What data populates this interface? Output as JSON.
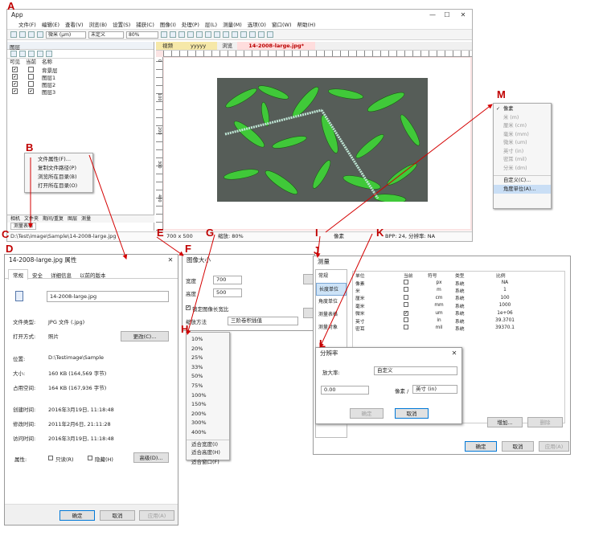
{
  "labels": {
    "A": "A",
    "B": "B",
    "C": "C",
    "D": "D",
    "E": "E",
    "F": "F",
    "G": "G",
    "H": "H",
    "I": "I",
    "J": "J",
    "K": "K",
    "L": "L",
    "M": "M"
  },
  "main": {
    "title": "App",
    "menus": [
      "文件(F)",
      "编辑(E)",
      "查看(V)",
      "浏览(B)",
      "设置(S)",
      "捕获(C)",
      "图像(I)",
      "处理(P)",
      "层(L)",
      "测量(M)",
      "选项(O)",
      "窗口(W)",
      "帮助(H)"
    ],
    "unit_select": "微米 (μm)",
    "calib_select": "未定义",
    "zoom_select": "80%",
    "layers_title": "图层",
    "layers_headers": [
      "可见",
      "当前",
      "名称"
    ],
    "layers": [
      {
        "name": "背景层",
        "vis": "✔",
        "cur": ""
      },
      {
        "name": "图层1",
        "vis": "✔",
        "cur": ""
      },
      {
        "name": "图层2",
        "vis": "✔",
        "cur": ""
      },
      {
        "name": "图层3",
        "vis": "✔",
        "cur": "✔"
      }
    ],
    "bottom_tabs": [
      "相机",
      "文件夹",
      "期间/重复",
      "图层",
      "测量"
    ],
    "bottom_tab2": "测量表格",
    "doc_tabs": [
      "视频",
      "yyyyy",
      "浏览",
      "14-2008-large.jpg*"
    ],
    "ruler_v": [
      "0",
      "100",
      "200",
      "300",
      "400"
    ],
    "status": {
      "path": "D:\\Test\\image\\Sample\\14-2008-large.jpg",
      "size": "700 x 500",
      "zoom": "缩放: 80%",
      "unit": "像素",
      "bpp": "BPP: 24, 分辨率: NA"
    }
  },
  "context_menu": {
    "items": [
      "文件属性(F)...",
      "复制文件路径(P)",
      "浏览所在目录(B)",
      "打开所在目录(O)"
    ]
  },
  "props": {
    "title": "14-2008-large.jpg 属性",
    "tabs": [
      "常规",
      "安全",
      "详细信息",
      "以前的版本"
    ],
    "filename": "14-2008-large.jpg",
    "rows": [
      {
        "k": "文件类型:",
        "v": "JPG 文件 (.jpg)"
      },
      {
        "k": "打开方式:",
        "v": "照片"
      },
      {
        "k": "位置:",
        "v": "D:\\Testimage\\Sample"
      },
      {
        "k": "大小:",
        "v": "160 KB (164,569 字节)"
      },
      {
        "k": "占用空间:",
        "v": "164 KB (167,936 字节)"
      },
      {
        "k": "创建时间:",
        "v": "2016年3月19日, 11:18:48"
      },
      {
        "k": "修改时间:",
        "v": "2011年2月6日, 21:11:28"
      },
      {
        "k": "访问时间:",
        "v": "2016年3月19日, 11:18:48"
      }
    ],
    "change_btn": "更改(C)...",
    "attr_label": "属性:",
    "readonly": "只读(R)",
    "hidden": "隐藏(H)",
    "advanced": "高级(D)...",
    "ok": "确定",
    "cancel": "取消",
    "apply": "应用(A)"
  },
  "resize": {
    "title": "图像大小",
    "width_label": "宽度",
    "width": "700",
    "height_label": "高度",
    "height": "500",
    "keep": "锁定图像长宽比",
    "method_label": "缩放方法",
    "method": "三阶卷积插值"
  },
  "zoom_menu": {
    "items": [
      "10%",
      "20%",
      "25%",
      "33%",
      "50%",
      "75%",
      "100%",
      "150%",
      "200%",
      "300%",
      "400%"
    ],
    "fit": [
      "适合宽度(I)",
      "适合高度(H)",
      "适合窗口(F)"
    ]
  },
  "unit_menu": {
    "items": [
      "像素",
      "米 (m)",
      "厘米 (cm)",
      "毫米 (mm)",
      "微米 (um)",
      "英寸 (in)",
      "密耳 (mil)",
      "分米 (dm)"
    ],
    "custom": "自定义(C)...",
    "angle": "角度单位(A)..."
  },
  "measure": {
    "title": "测量",
    "side": [
      "常规",
      "长度单位",
      "角度单位",
      "测量表格",
      "测量对象"
    ],
    "headers": [
      "单位",
      "当前",
      "符号",
      "类型",
      "比例"
    ],
    "rows": [
      {
        "unit": "像素",
        "cur": "",
        "sym": "px",
        "type": "系统",
        "ratio": "NA"
      },
      {
        "unit": "米",
        "cur": "",
        "sym": "m",
        "type": "系统",
        "ratio": "1"
      },
      {
        "unit": "厘米",
        "cur": "",
        "sym": "cm",
        "type": "系统",
        "ratio": "100"
      },
      {
        "unit": "毫米",
        "cur": "",
        "sym": "mm",
        "type": "系统",
        "ratio": "1000"
      },
      {
        "unit": "微米",
        "cur": "✔",
        "sym": "um",
        "type": "系统",
        "ratio": "1e+06"
      },
      {
        "unit": "英寸",
        "cur": "",
        "sym": "in",
        "type": "系统",
        "ratio": "39.3701"
      },
      {
        "unit": "密耳",
        "cur": "",
        "sym": "mil",
        "type": "系统",
        "ratio": "39370.1"
      }
    ],
    "add": "增加...",
    "delete": "删除",
    "ok": "确定",
    "cancel": "取消",
    "apply": "应用(A)"
  },
  "resolution": {
    "title": "分辨率",
    "mag_label": "放大率:",
    "mag": "自定义",
    "value": "0.00",
    "px_label": "像素 /",
    "unit": "英寸 (in)",
    "ok": "确定",
    "cancel": "取消"
  }
}
